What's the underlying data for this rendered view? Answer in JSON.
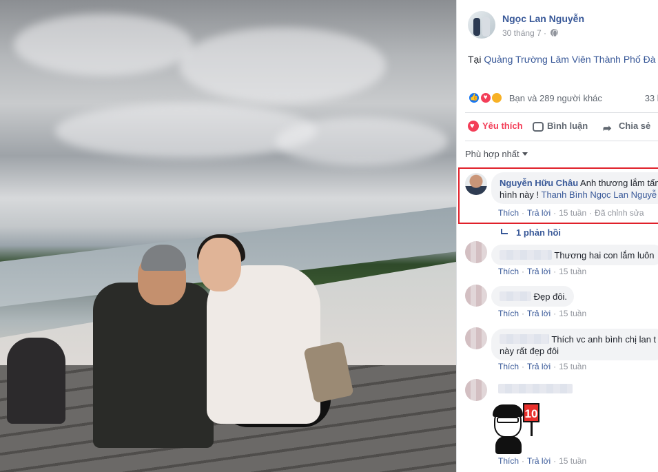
{
  "post": {
    "author": "Ngọc Lan Nguyễn",
    "date": "30 tháng 7 ·",
    "location_prefix": "Tại",
    "location_name": "Quảng Trường Lâm Viên Thành Phố Đà",
    "reactions_text": "Bạn và 289 người khác",
    "comments_count": "33 b"
  },
  "actions": {
    "like": "Yêu thích",
    "comment": "Bình luận",
    "share": "Chia sẻ"
  },
  "sort": {
    "label": "Phù hợp nhất"
  },
  "comments": [
    {
      "name": "Nguyễn Hữu Châu",
      "text_1": "Anh thương lắm tấm",
      "text_2a": "hình này !",
      "mention": "Thanh Bình Ngọc Lan Nguyễ",
      "like": "Thích",
      "reply": "Trả lời",
      "time": "15 tuần",
      "edited": "Đã chỉnh sửa"
    },
    {
      "text": "Thương hai con lắm luôn",
      "like": "Thích",
      "reply": "Trả lời",
      "time": "15 tuần"
    },
    {
      "text": "Đẹp đôi.",
      "like": "Thích",
      "reply": "Trả lời",
      "time": "15 tuần"
    },
    {
      "text_1": "Thích vc anh bình chị lan t",
      "text_2": "này rất đẹp đôi",
      "like": "Thích",
      "reply": "Trả lời",
      "time": "15 tuần"
    },
    {
      "sticker_sign": "10",
      "like": "Thích",
      "reply": "Trả lời",
      "time": "15 tuần"
    }
  ],
  "replies": {
    "label": "1 phản hồi"
  },
  "colors": {
    "link": "#385898",
    "love": "#f33e58",
    "highlight": "#e0202a",
    "muted": "#90949c"
  }
}
